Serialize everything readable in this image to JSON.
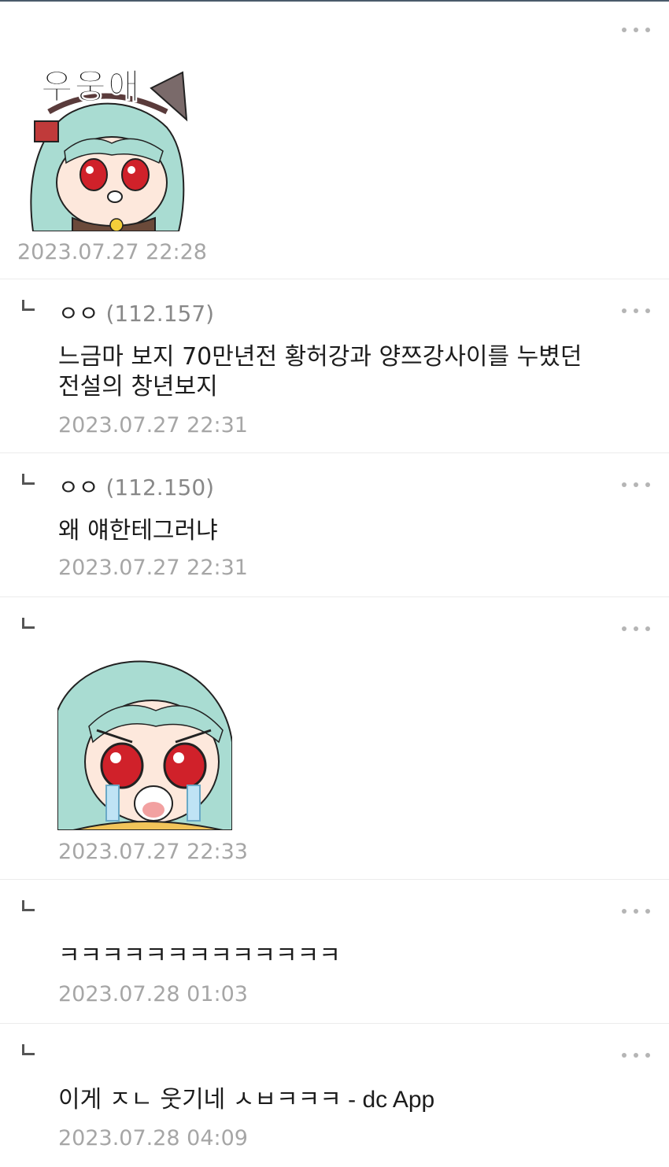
{
  "comments": [
    {
      "id": "c0",
      "type": "sticker",
      "sticker_caption": "우웅애",
      "date": "2023.07.27 22:28"
    },
    {
      "id": "c1",
      "type": "reply",
      "author": "ㅇㅇ",
      "ip": "(112.157)",
      "text_line1": "느금마 보지 70만년전 황허강과 양쯔강사이를 누볐던",
      "text_line2": "전설의 창년보지",
      "date": "2023.07.27 22:31"
    },
    {
      "id": "c2",
      "type": "reply",
      "author": "ㅇㅇ",
      "ip": "(112.150)",
      "text_line1": "왜 얘한테그러냐",
      "date": "2023.07.27 22:31"
    },
    {
      "id": "c3",
      "type": "reply-sticker",
      "date": "2023.07.27 22:33"
    },
    {
      "id": "c4",
      "type": "reply",
      "text_line1": "ㅋㅋㅋㅋㅋㅋㅋㅋㅋㅋㅋㅋㅋ",
      "date": "2023.07.28 01:03"
    },
    {
      "id": "c5",
      "type": "reply",
      "text_main": "이게 ㅈㄴ 웃기네 ㅅㅂㅋㅋㅋ",
      "text_suffix": " - dc App",
      "date": "2023.07.28 04:09"
    }
  ],
  "icons": {
    "more": "more-dots-icon",
    "reply": "reply-arrow-icon"
  },
  "colors": {
    "date": "#a6a6a6",
    "divider": "#ececec",
    "hair": "#a9dcd2",
    "eye": "#d0212a"
  }
}
